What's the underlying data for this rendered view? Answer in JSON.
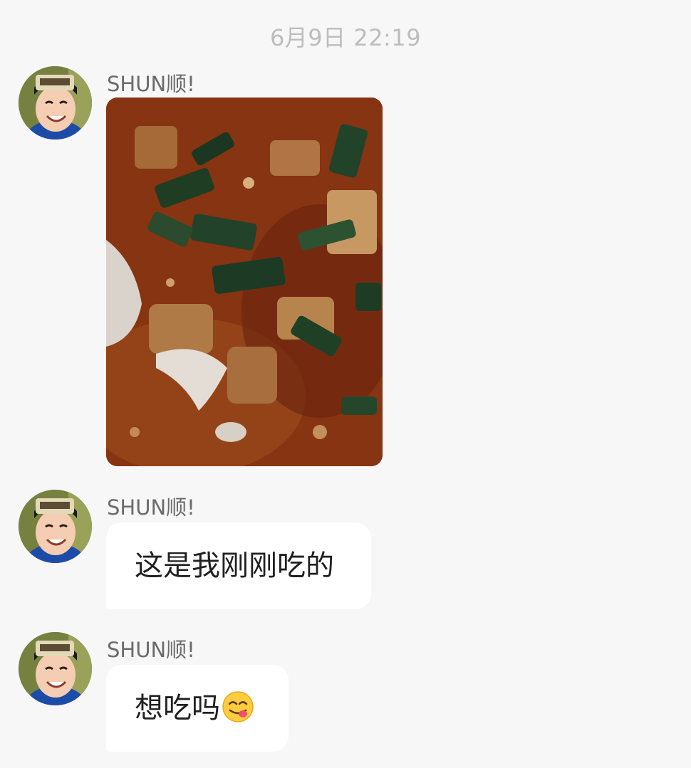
{
  "timestamp": "6月9日 22:19",
  "messages": [
    {
      "sender": "SHUN顺!",
      "type": "image",
      "image_label": "photo of spicy tofu dish with green onions"
    },
    {
      "sender": "SHUN顺!",
      "type": "text",
      "text": "这是我刚刚吃的"
    },
    {
      "sender": "SHUN顺!",
      "type": "text",
      "text": "想吃吗",
      "emoji": "yum-face-icon"
    }
  ],
  "colors": {
    "background": "#f7f7f7",
    "bubble": "#ffffff",
    "timestamp_text": "#bdbdbd",
    "sender_text": "#6b6b6b",
    "message_text": "#202020"
  }
}
